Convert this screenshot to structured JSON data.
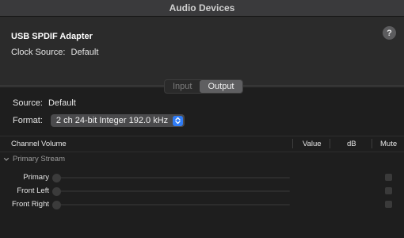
{
  "window": {
    "title": "Audio Devices"
  },
  "device": {
    "name": "USB SPDIF Adapter",
    "clock_source_label": "Clock Source:",
    "clock_source_value": "Default",
    "help_label": "?"
  },
  "io_tabs": [
    {
      "label": "Input",
      "active": false
    },
    {
      "label": "Output",
      "active": true
    }
  ],
  "source": {
    "label": "Source:",
    "value": "Default"
  },
  "format": {
    "label": "Format:",
    "value": "2 ch 24-bit Integer 192.0 kHz"
  },
  "table": {
    "columns": {
      "channel_volume": "Channel Volume",
      "value": "Value",
      "db": "dB",
      "mute": "Mute"
    },
    "group": {
      "label": "Primary Stream",
      "expanded": true
    },
    "channels": [
      {
        "name": "Primary",
        "muted": false
      },
      {
        "name": "Front Left",
        "muted": false
      },
      {
        "name": "Front Right",
        "muted": false
      }
    ]
  },
  "colors": {
    "accent": "#2f7cf6",
    "background": "#1e1e1e",
    "header_background": "#2b2b2b",
    "titlebar": "#3a3a3c"
  },
  "icons": {
    "help": "question-mark-icon",
    "select": "up-down-chevrons-icon",
    "disclosure": "chevron-down-icon"
  }
}
